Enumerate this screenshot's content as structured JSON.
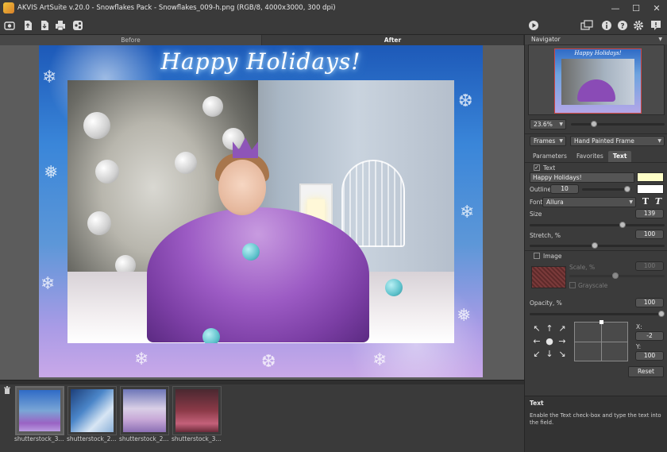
{
  "window": {
    "title": "AKVIS ArtSuite v.20.0 - Snowflakes Pack - Snowflakes_009-h.png (RGB/8, 4000x3000, 300 dpi)",
    "minimize": "—",
    "maximize": "☐",
    "close": "✕"
  },
  "view_tabs": {
    "before": "Before",
    "after": "After"
  },
  "canvas": {
    "overlay_text": "Happy Holidays!"
  },
  "filmstrip": {
    "thumbnails": [
      {
        "label": "shutterstock_3..."
      },
      {
        "label": "shutterstock_2..."
      },
      {
        "label": "shutterstock_2..."
      },
      {
        "label": "shutterstock_3..."
      }
    ]
  },
  "panel": {
    "navigator_title": "Navigator",
    "navigator_overlay": "Happy Holidays!",
    "zoom": "23.6%",
    "category": "Frames",
    "frame_type": "Hand Painted Frame",
    "tabs": [
      "Parameters",
      "Favorites",
      "Text"
    ],
    "text_checkbox_label": "Text",
    "text_value": "Happy Holidays!",
    "outline_label": "Outline",
    "outline_value": "10",
    "font_label": "Font",
    "font_value": "Allura",
    "bold_glyph": "T",
    "italic_glyph": "T",
    "size_label": "Size",
    "size_value": "139",
    "stretch_label": "Stretch, %",
    "stretch_value": "100",
    "image_label": "Image",
    "scale_label": "Scale, %",
    "scale_value": "100",
    "grayscale_label": "Grayscale",
    "opacity_label": "Opacity, %",
    "opacity_value": "100",
    "x_label": "X:",
    "x_value": "-2",
    "y_label": "Y:",
    "y_value": "100",
    "reset_label": "Reset",
    "sliders": {
      "zoom_level": 0.23,
      "outline_level": 0.98,
      "size_level": 0.7,
      "stretch_level": 0.48,
      "scale_level": 0.48,
      "opacity_level": 1.0
    }
  },
  "help": {
    "title": "Text",
    "body": "Enable the Text check-box and type the text into the field."
  },
  "colors": {
    "text_color": "#ffffc8",
    "outline_color": "#ffffff",
    "accent_red": "#d04545"
  }
}
